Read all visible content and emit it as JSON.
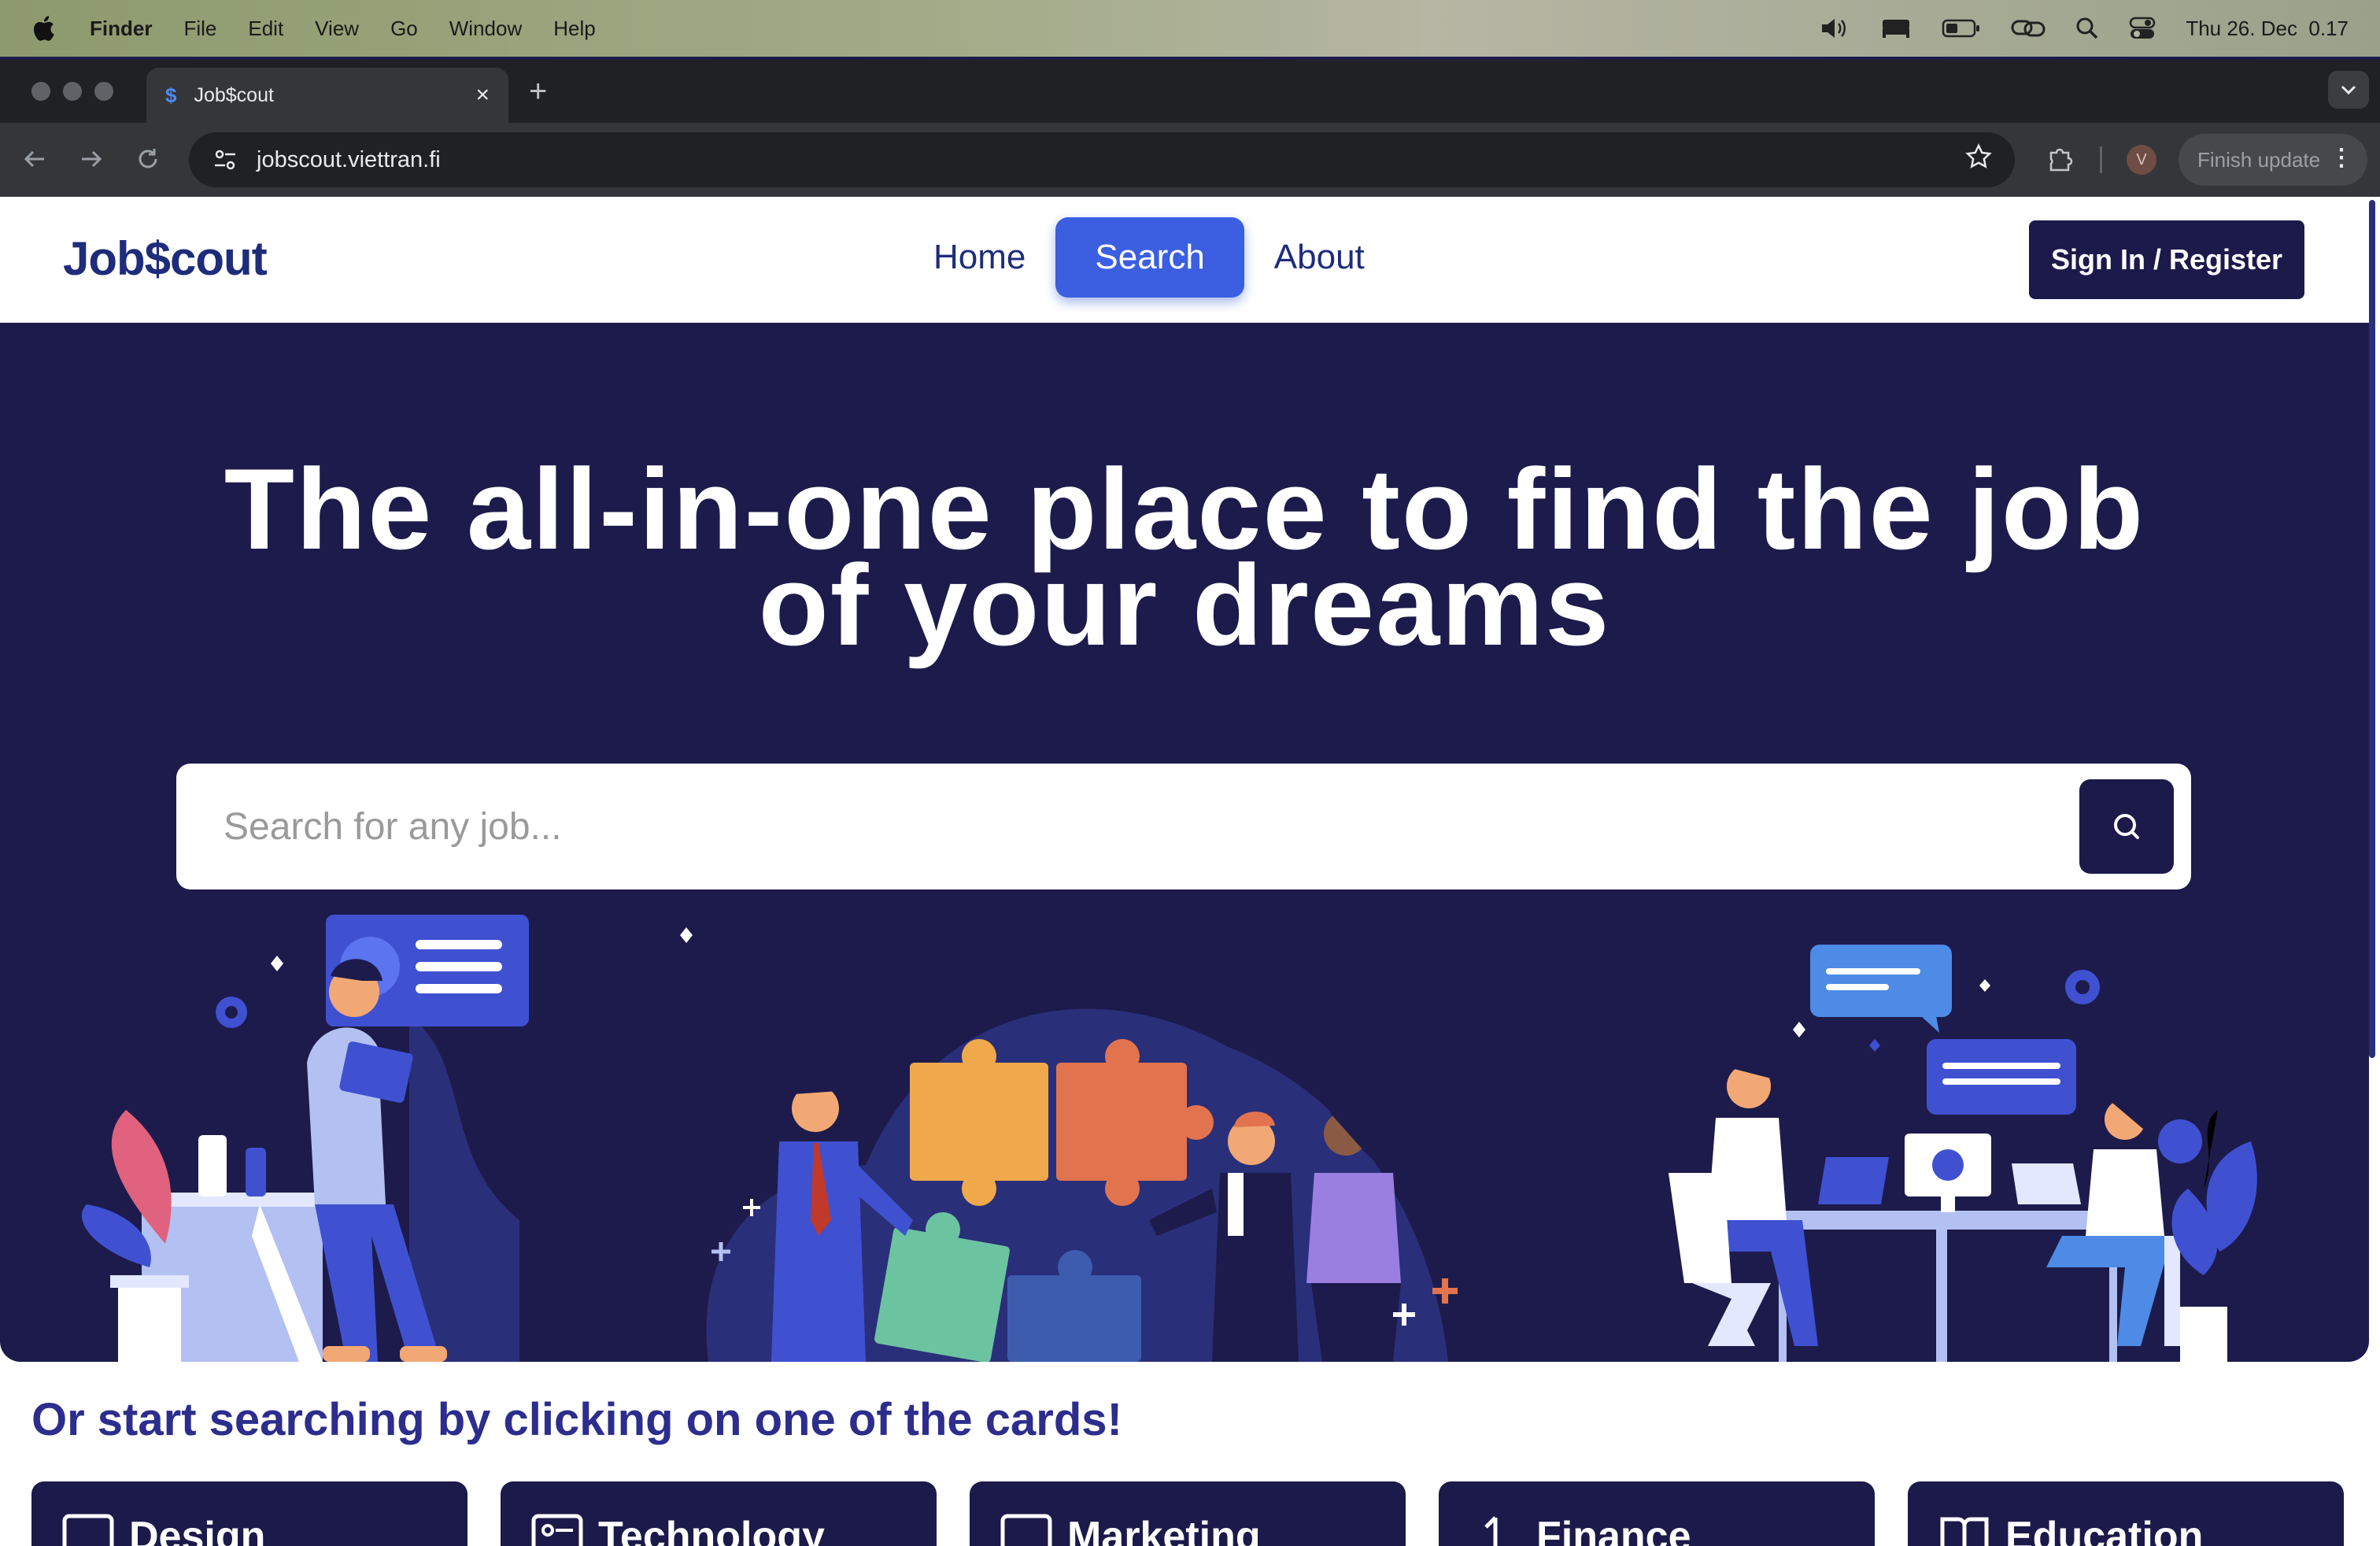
{
  "menubar": {
    "app": "Finder",
    "items": [
      "File",
      "Edit",
      "View",
      "Go",
      "Window",
      "Help"
    ],
    "datetime": "Thu 26. Dec  0.17"
  },
  "browser": {
    "tab_title": "Job$cout",
    "tab_favicon": "$",
    "url": "jobscout.viettran.fi",
    "profile_initial": "V",
    "finish_update": "Finish update"
  },
  "site": {
    "logo": "Job$cout",
    "nav": [
      {
        "label": "Home",
        "active": false
      },
      {
        "label": "Search",
        "active": true
      },
      {
        "label": "About",
        "active": false
      }
    ],
    "signin": "Sign In / Register",
    "hero_title_line1": "The all-in-one place to find the job",
    "hero_title_line2": "of your dreams",
    "search_placeholder": "Search for any job...",
    "cards_heading": "Or start searching by clicking on one of the cards!",
    "cards": [
      {
        "label": "Design",
        "icon": "design-icon"
      },
      {
        "label": "Technology",
        "icon": "technology-icon"
      },
      {
        "label": "Marketing",
        "icon": "marketing-icon"
      },
      {
        "label": "Finance",
        "icon": "finance-icon"
      },
      {
        "label": "Education",
        "icon": "book-icon"
      }
    ]
  },
  "colors": {
    "navy": "#1d1b4b",
    "brand_blue": "#1e2c7b",
    "active_nav": "#3b5fe0",
    "heading_purple": "#2c2d8c"
  }
}
